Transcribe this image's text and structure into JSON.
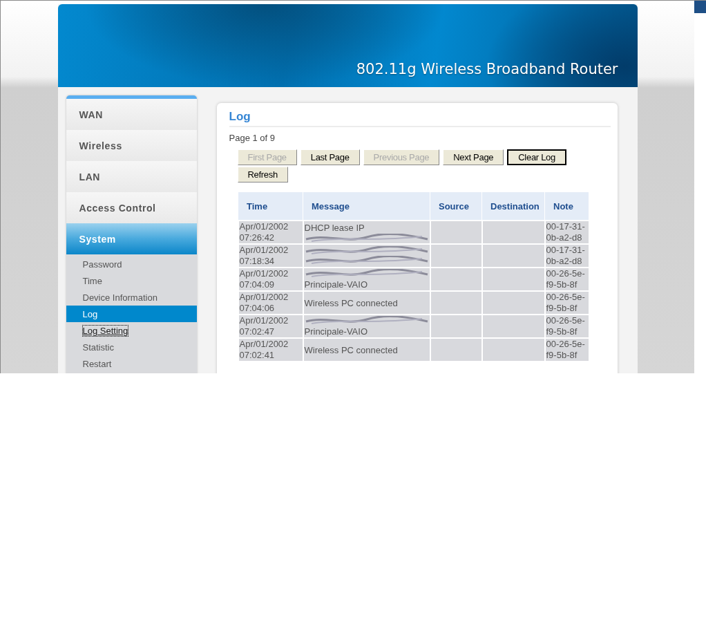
{
  "header": {
    "title": "802.11g Wireless Broadband Router"
  },
  "sidebar": {
    "items": [
      {
        "label": "WAN",
        "selected": false
      },
      {
        "label": "Wireless",
        "selected": false
      },
      {
        "label": "LAN",
        "selected": false
      },
      {
        "label": "Access Control",
        "selected": false
      },
      {
        "label": "System",
        "selected": true,
        "children": [
          {
            "label": "Password",
            "selected": false,
            "focused": false
          },
          {
            "label": "Time",
            "selected": false,
            "focused": false
          },
          {
            "label": "Device Information",
            "selected": false,
            "focused": false
          },
          {
            "label": "Log",
            "selected": true,
            "focused": false
          },
          {
            "label": "Log Setting",
            "selected": false,
            "focused": true
          },
          {
            "label": "Statistic",
            "selected": false,
            "focused": false
          },
          {
            "label": "Restart",
            "selected": false,
            "focused": false
          }
        ]
      }
    ]
  },
  "panel": {
    "title": "Log",
    "page_info": "Page 1 of 9",
    "buttons": [
      {
        "label": "First Page",
        "disabled": true,
        "focused": false
      },
      {
        "label": "Last Page",
        "disabled": false,
        "focused": false
      },
      {
        "label": "Previous Page",
        "disabled": true,
        "focused": false
      },
      {
        "label": "Next Page",
        "disabled": false,
        "focused": false
      },
      {
        "label": "Clear Log",
        "disabled": false,
        "focused": true
      },
      {
        "label": "Refresh",
        "disabled": false,
        "focused": false
      }
    ],
    "table": {
      "columns": [
        "Time",
        "Message",
        "Source",
        "Destination",
        "Note"
      ],
      "rows": [
        {
          "time": "Apr/01/2002 07:26:42",
          "message": [
            {
              "kind": "text",
              "text": "DHCP lease IP"
            },
            {
              "kind": "redacted"
            }
          ],
          "note": "00-17-31-0b-a2-d8"
        },
        {
          "time": "Apr/01/2002 07:18:34",
          "message": [
            {
              "kind": "redacted"
            },
            {
              "kind": "redacted"
            }
          ],
          "note": "00-17-31-0b-a2-d8"
        },
        {
          "time": "Apr/01/2002 07:04:09",
          "message": [
            {
              "kind": "redacted"
            },
            {
              "kind": "text",
              "text": "Principale-VAIO"
            }
          ],
          "note": "00-26-5e-f9-5b-8f"
        },
        {
          "time": "Apr/01/2002 07:04:06",
          "message": [
            {
              "kind": "text",
              "text": "Wireless PC connected"
            }
          ],
          "note": "00-26-5e-f9-5b-8f"
        },
        {
          "time": "Apr/01/2002 07:02:47",
          "message": [
            {
              "kind": "redacted"
            },
            {
              "kind": "text",
              "text": "Principale-VAIO"
            }
          ],
          "note": "00-26-5e-f9-5b-8f"
        },
        {
          "time": "Apr/01/2002 07:02:41",
          "message": [
            {
              "kind": "text",
              "text": "Wireless PC connected"
            }
          ],
          "note": "00-26-5e-f9-5b-8f"
        }
      ]
    }
  }
}
